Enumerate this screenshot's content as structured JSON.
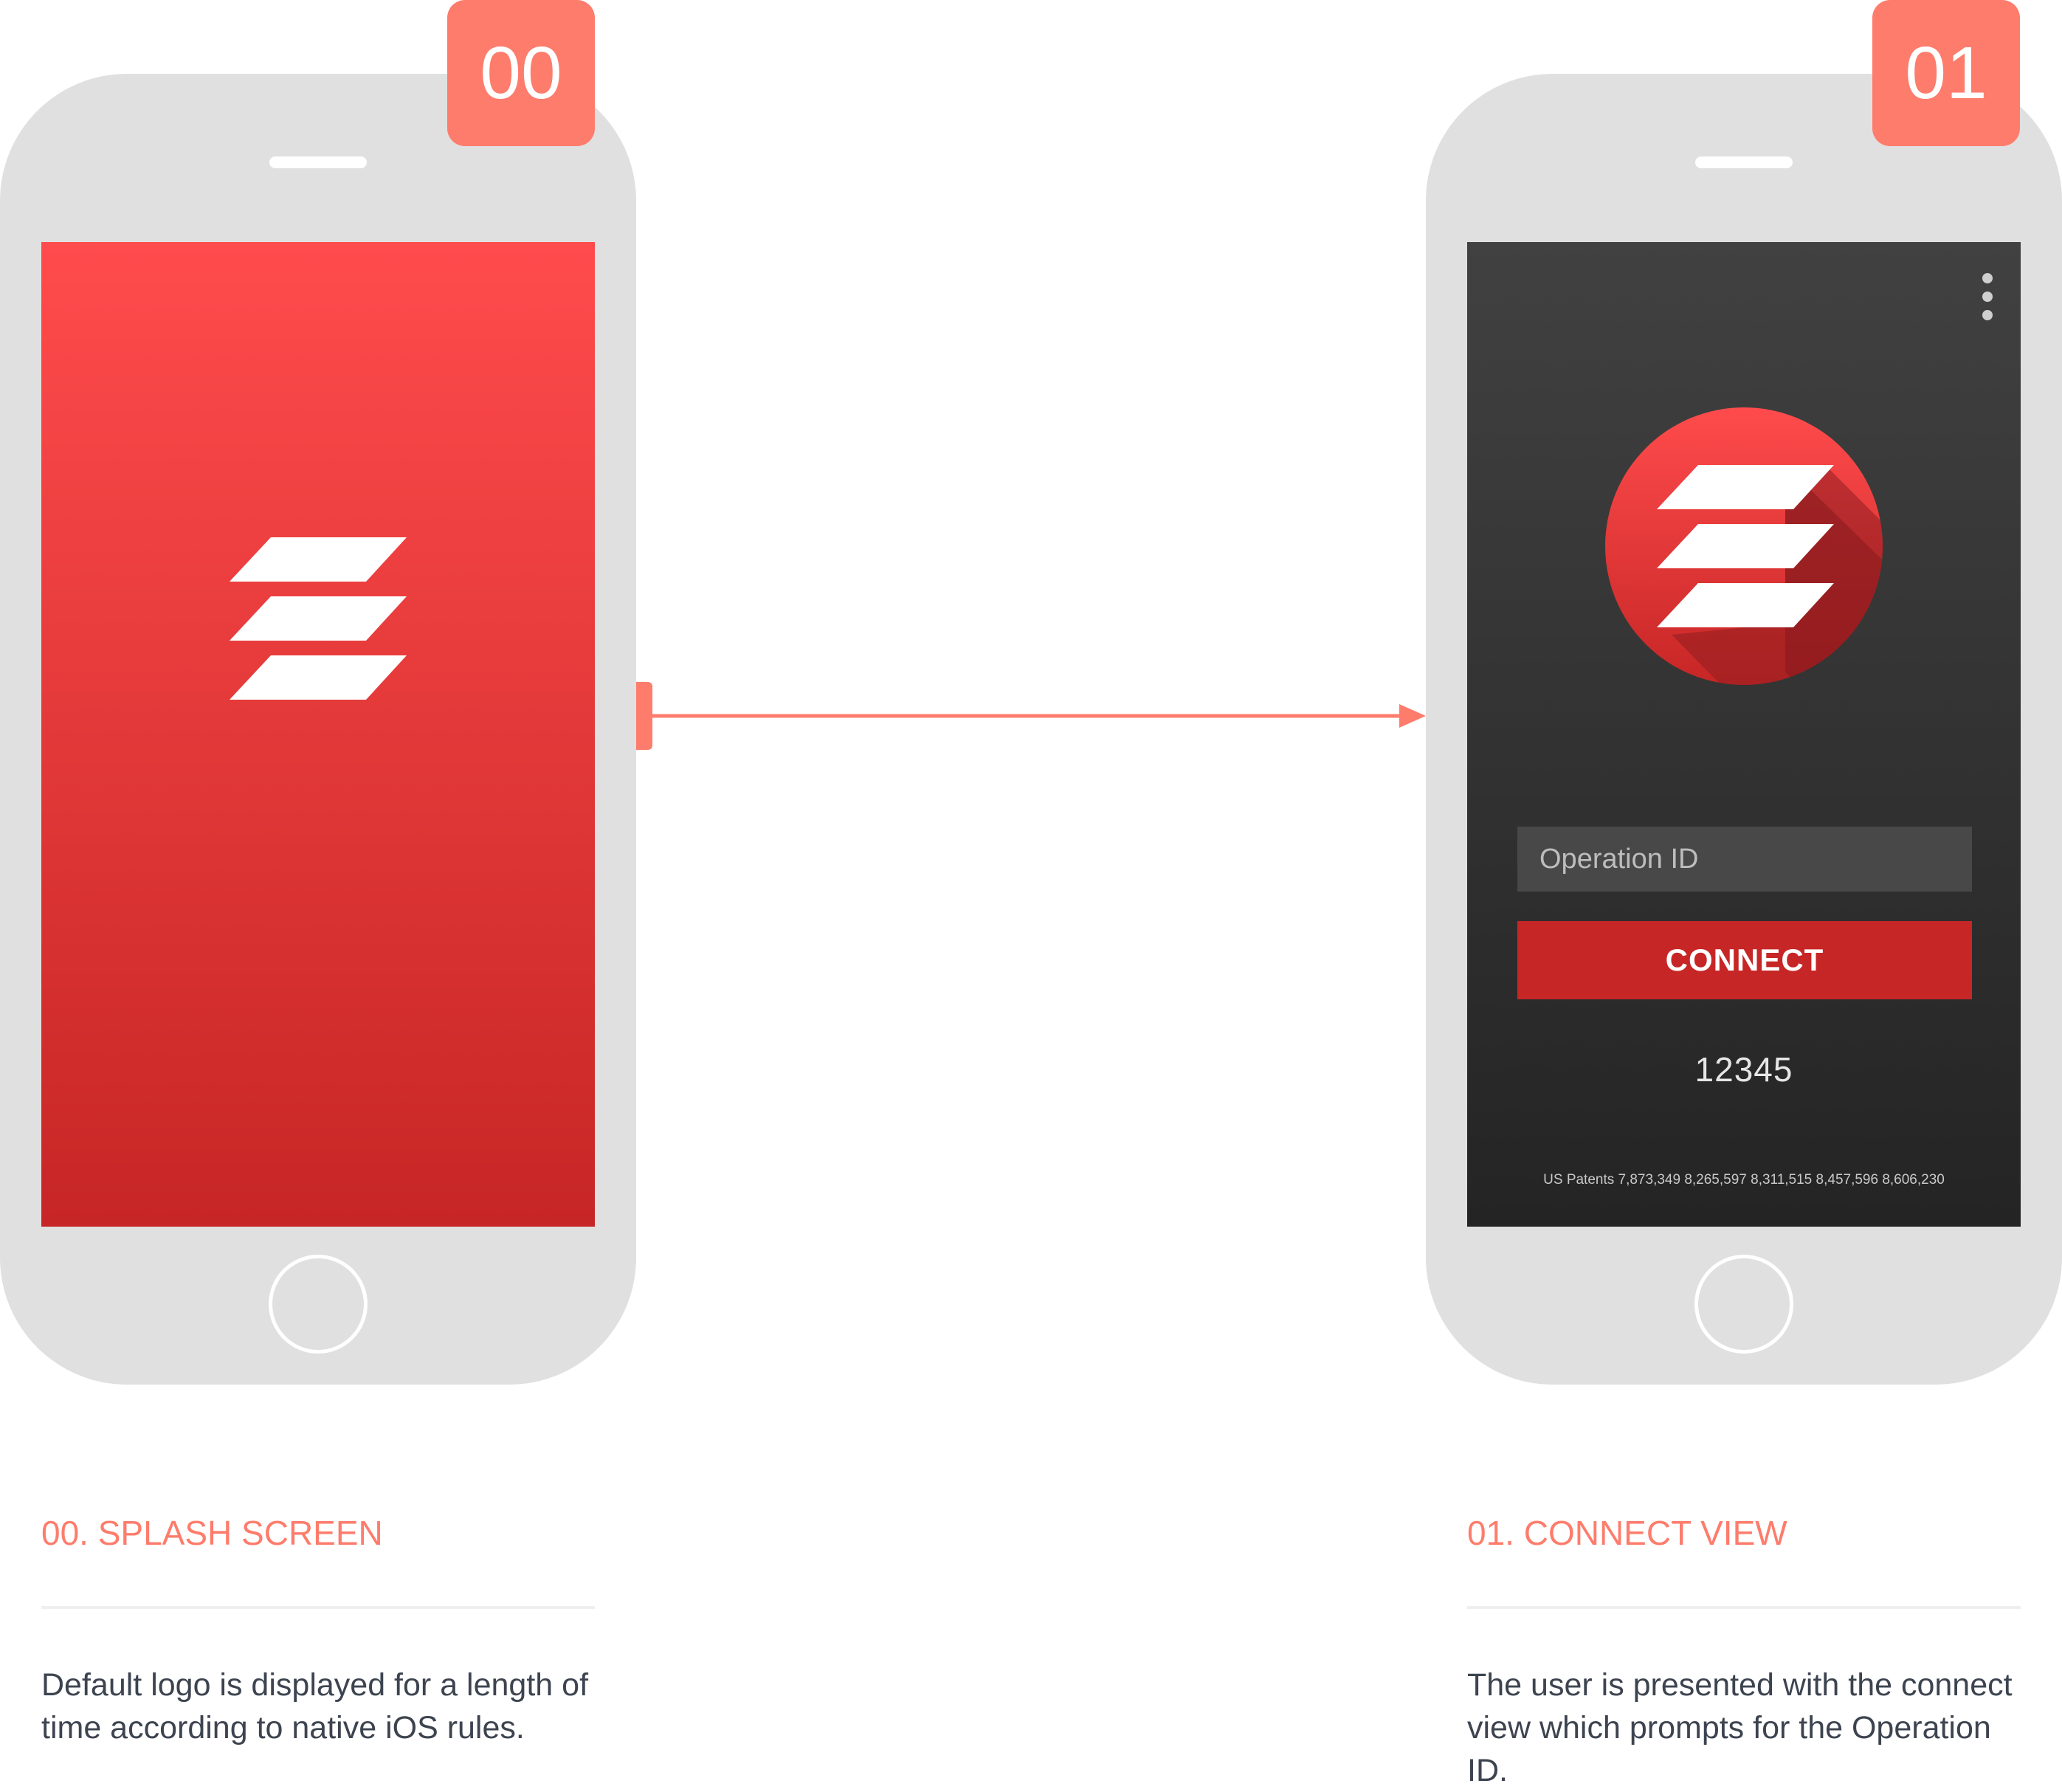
{
  "screens": [
    {
      "badge": "00",
      "caption_title": "00. SPLASH SCREEN",
      "caption_desc": "Default logo is displayed for a length of time according to native iOS rules."
    },
    {
      "badge": "01",
      "caption_title": "01. CONNECT VIEW",
      "caption_desc": "The user is presented with the connect view which prompts for the Operation ID."
    }
  ],
  "connect_view": {
    "input_placeholder": "Operation ID",
    "connect_label": "CONNECT",
    "operation_number": "12345",
    "patents": "US Patents 7,873,349 8,265,597 8,311,515 8,457,596 8,606,230"
  },
  "colors": {
    "accent": "#fe7c6c",
    "brand_red": "#c72626",
    "splash_top": "#ff4b4c",
    "connect_bg": "#333333"
  },
  "icons": [
    "app-logo-icon",
    "overflow-menu-icon",
    "arrow-right-icon"
  ]
}
